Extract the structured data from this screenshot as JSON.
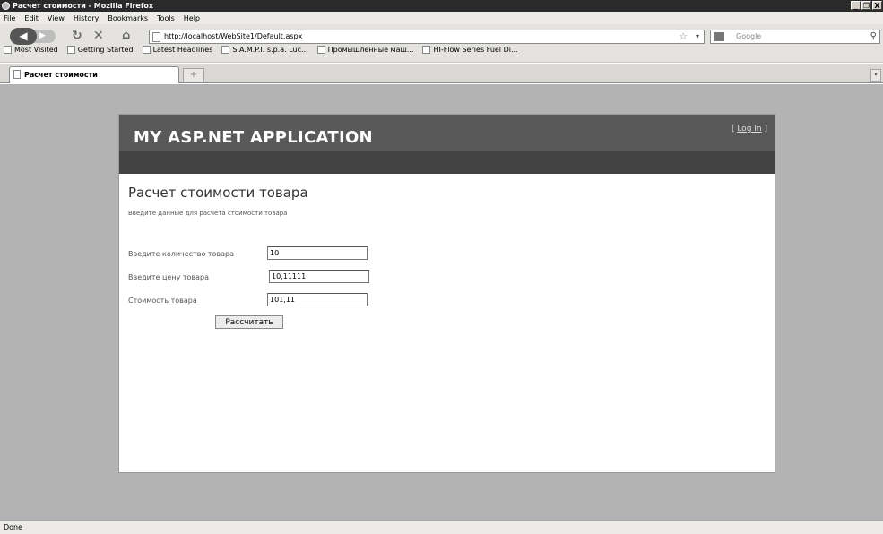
{
  "window": {
    "title": "Расчет стоимости - Mozilla Firefox",
    "controls": [
      "_",
      "❐",
      "X"
    ]
  },
  "menu": [
    "File",
    "Edit",
    "View",
    "History",
    "Bookmarks",
    "Tools",
    "Help"
  ],
  "nav": {
    "url": "http://localhost/WebSite1/Default.aspx",
    "search_placeholder": "Google"
  },
  "bookmarks": [
    "Most Visited",
    "Getting Started",
    "Latest Headlines",
    "S.A.M.P.I. s.p.a. Luc...",
    "Промышленные маш...",
    "HI-Flow Series Fuel Di..."
  ],
  "tab": {
    "label": "Расчет стоимости",
    "new_tab": "+"
  },
  "site": {
    "brand": "MY ASP.NET APPLICATION",
    "login_prefix": "[ ",
    "login_link": "Log In",
    "login_suffix": " ]"
  },
  "content": {
    "heading": "Расчет стоимости товара",
    "intro": "Введите данные для расчета стоимости товара",
    "fields": [
      {
        "label": "Введите количество товара",
        "value": "10"
      },
      {
        "label": "Введите цену товара",
        "value": "10,11111"
      },
      {
        "label": "Стоимость товара",
        "value": "101,11"
      }
    ],
    "button": "Рассчитать"
  },
  "status": "Done"
}
